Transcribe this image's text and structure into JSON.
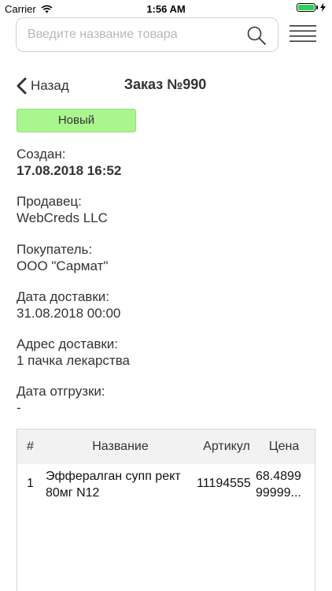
{
  "status_bar": {
    "carrier": "Carrier",
    "time": "1:56 AM",
    "battery_level": 1.0
  },
  "search": {
    "placeholder": "Введите название товара",
    "value": ""
  },
  "nav": {
    "back_label": "Назад",
    "title": "Заказ №990"
  },
  "order": {
    "status": "Новый",
    "status_color": "#a9f58e",
    "fields": [
      {
        "label": "Создан:",
        "value": "17.08.2018 16:52"
      },
      {
        "label": "Продавец:",
        "value": "WebCreds LLC"
      },
      {
        "label": "Покупатель:",
        "value": "ООО \"Сармат\""
      },
      {
        "label": "Дата доставки:",
        "value": "31.08.2018 00:00"
      },
      {
        "label": "Адрес доставки:",
        "value": "1 пачка лекарства"
      },
      {
        "label": "Дата отгрузки:",
        "value": "-"
      }
    ]
  },
  "table": {
    "headers": {
      "num": "#",
      "name": "Название",
      "article": "Артикул",
      "price": "Цена"
    },
    "rows": [
      {
        "num": "1",
        "name": "Эффералган супп рект 80мг N12",
        "article": "11194555",
        "price": "68.4899 99999..."
      }
    ]
  },
  "icons": {
    "search": "search-icon",
    "menu": "hamburger-menu-icon",
    "back": "chevron-left-icon",
    "wifi": "wifi-icon",
    "battery": "battery-icon",
    "charging": "charging-bolt-icon"
  },
  "colors": {
    "status_badge": "#a9f58e",
    "text": "#333333",
    "table_header_bg": "#f2f2f2"
  }
}
